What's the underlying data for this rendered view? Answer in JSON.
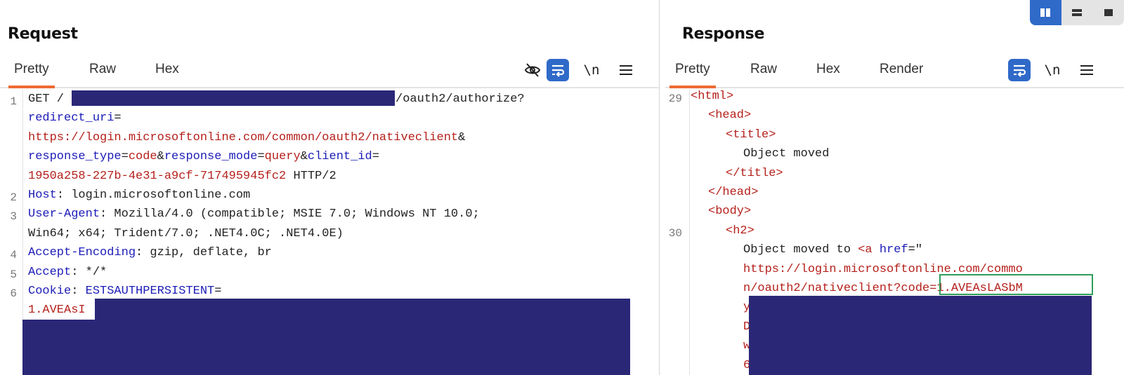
{
  "layout_toggle": {
    "items": [
      "split-view-icon",
      "horizontal-view-icon",
      "single-view-icon"
    ],
    "active_index": 0,
    "accent": "#2f6ac9"
  },
  "request": {
    "title": "Request",
    "tabs": [
      "Pretty",
      "Raw",
      "Hex"
    ],
    "active_tab": "Pretty",
    "tools": {
      "hide_icon": "eye-slash-icon",
      "wrap_icon": "word-wrap-icon",
      "newline_label": "\\n",
      "menu_icon": "menu-icon"
    },
    "lines": {
      "l1_num": "1",
      "l1_method": "GET /",
      "l1_path_end": "/oauth2/authorize?",
      "l1_redirect_key": "redirect_uri",
      "l1_eq": "=",
      "l1_redirect_val": "https://login.microsoftonline.com/common/oauth2/nativeclient",
      "l1_amp": "&",
      "l1_rt_key": "response_type",
      "l1_rt_val": "code",
      "l1_rm_key": "response_mode",
      "l1_rm_val": "query",
      "l1_cid_key": "client_id",
      "l1_cid_val": "1950a258-227b-4e31-a9cf-717495945fc2",
      "l1_proto": " HTTP/2",
      "l2_num": "2",
      "l2_key": "Host",
      "l2_val": ": login.microsoftonline.com",
      "l3_num": "3",
      "l3_key": "User-Agent",
      "l3_val": ": Mozilla/4.0 (compatible; MSIE 7.0; Windows NT 10.0;",
      "l3_val2": "Win64; x64; Trident/7.0; .NET4.0C; .NET4.0E)",
      "l4_num": "4",
      "l4_key": "Accept-Encoding",
      "l4_val": ": gzip, deflate, br",
      "l5_num": "5",
      "l5_key": "Accept",
      "l5_val": ": */*",
      "l6_num": "6",
      "l6_key": "Cookie",
      "l6_colon": ": ",
      "l6_cookie_name": "ESTSAUTHPERSISTENT",
      "l6_eq": "=",
      "l6_cookie_val": "1.AVEAsI"
    }
  },
  "response": {
    "title": "Response",
    "tabs": [
      "Pretty",
      "Raw",
      "Hex",
      "Render"
    ],
    "active_tab": "Pretty",
    "tools": {
      "wrap_icon": "word-wrap-icon",
      "newline_label": "\\n",
      "menu_icon": "menu-icon"
    },
    "lines": {
      "n29": "29",
      "n30": "30",
      "html_open": "<html>",
      "head_open": "<head>",
      "title_open": "<title>",
      "title_text": "Object moved",
      "title_close": "</title>",
      "head_close": "</head>",
      "body_open": "<body>",
      "h2_open": "<h2>",
      "moved_text": "Object moved to ",
      "a_open": "<a",
      "href_attr": " href",
      "href_eq": "=\"",
      "url1": "https://login.microsoftonline.com/commo",
      "url2": "n/oauth2/nativeclient?",
      "code_val": "code=1.AVEAsLASbM",
      "frag1": "y",
      "frag2": "D",
      "frag3": "w",
      "frag4": "6"
    }
  }
}
